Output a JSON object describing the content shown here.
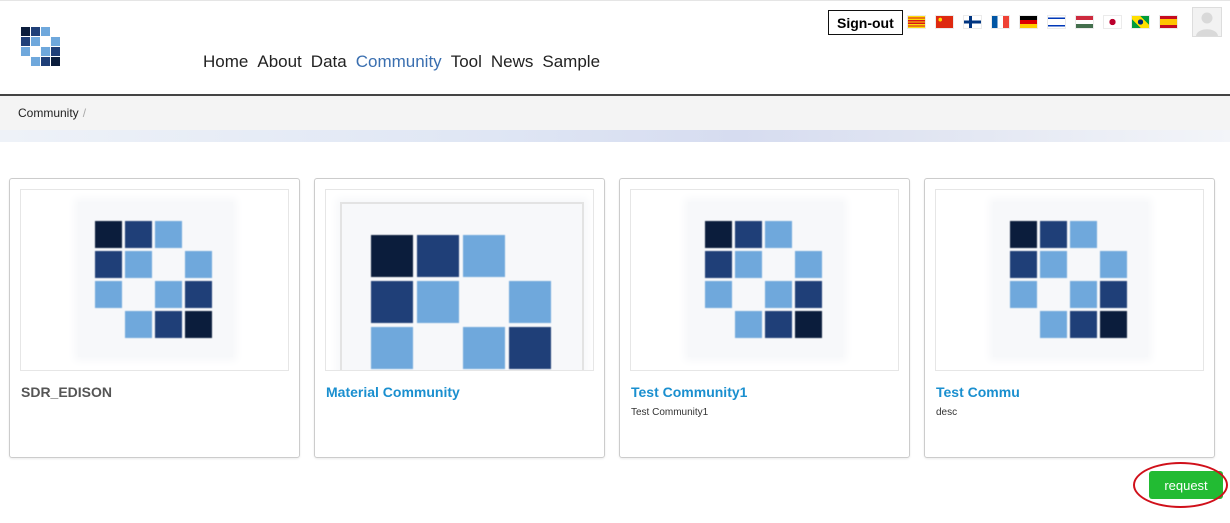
{
  "header": {
    "logo_name": "mosaic-logo",
    "nav": [
      {
        "label": "Home"
      },
      {
        "label": "About"
      },
      {
        "label": "Data"
      },
      {
        "label": "Community",
        "active": true
      },
      {
        "label": "Tool"
      },
      {
        "label": "News"
      },
      {
        "label": "Sample"
      }
    ],
    "signout_label": "Sign-out",
    "languages": [
      "catalan",
      "chinese",
      "finnish",
      "french",
      "german",
      "hebrew",
      "hungarian",
      "japanese",
      "portuguese-brazil",
      "spanish"
    ]
  },
  "breadcrumb": {
    "current": "Community",
    "separator": "/"
  },
  "cards": [
    {
      "title": "SDR_EDISON",
      "desc": "",
      "linked": false
    },
    {
      "title": "Material Community",
      "desc": "",
      "linked": true
    },
    {
      "title": "Test Community1",
      "desc": "Test Community1",
      "linked": true
    },
    {
      "title": "Test Commu",
      "desc": "desc",
      "linked": true
    }
  ],
  "actions": {
    "request_label": "request"
  },
  "colors": {
    "accent_link": "#1a8fcf",
    "nav_active": "#3a6fb0",
    "request_button": "#22bb33",
    "annotation": "#d0101a",
    "tile_dark": "#0b1d3c",
    "tile_mid": "#1f3f78",
    "tile_light": "#6fa8dc"
  }
}
